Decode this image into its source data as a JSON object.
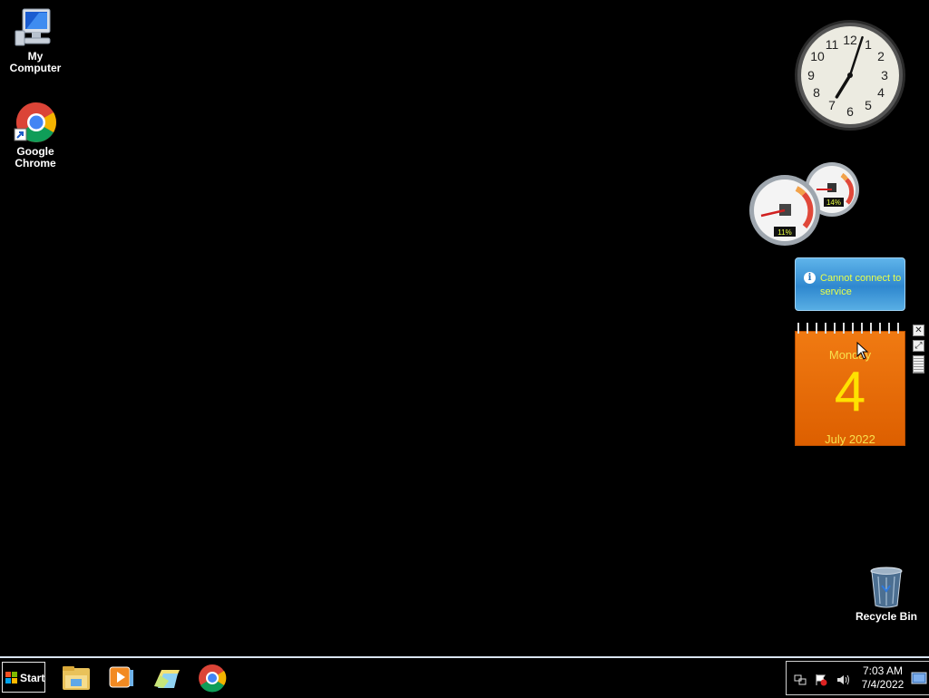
{
  "desktop": {
    "icons": [
      {
        "label": "My Computer"
      },
      {
        "label": "Google Chrome"
      },
      {
        "label": "Recycle Bin"
      }
    ]
  },
  "gadgets": {
    "clock": {
      "time": "7:03",
      "numerals": [
        "12",
        "1",
        "2",
        "3",
        "4",
        "5",
        "6",
        "7",
        "8",
        "9",
        "10",
        "11"
      ]
    },
    "cpu_meter": {
      "cpu_percent": "11%",
      "memory_percent": "14%"
    },
    "weather": {
      "message": "Cannot connect to service"
    },
    "calendar": {
      "weekday": "Monday",
      "day": "4",
      "month_year": "July 2022"
    }
  },
  "taskbar": {
    "start_label": "Start",
    "pinned": [
      "file-explorer-icon",
      "media-player-icon",
      "windows-explorer-icon",
      "chrome-icon"
    ],
    "tray": {
      "time": "7:03 AM",
      "date": "7/4/2022"
    }
  },
  "colors": {
    "desktop": "#000000",
    "calendar_orange": "#e66a06",
    "calendar_text": "#ffe200",
    "weather_blue": "#3b93d6"
  }
}
